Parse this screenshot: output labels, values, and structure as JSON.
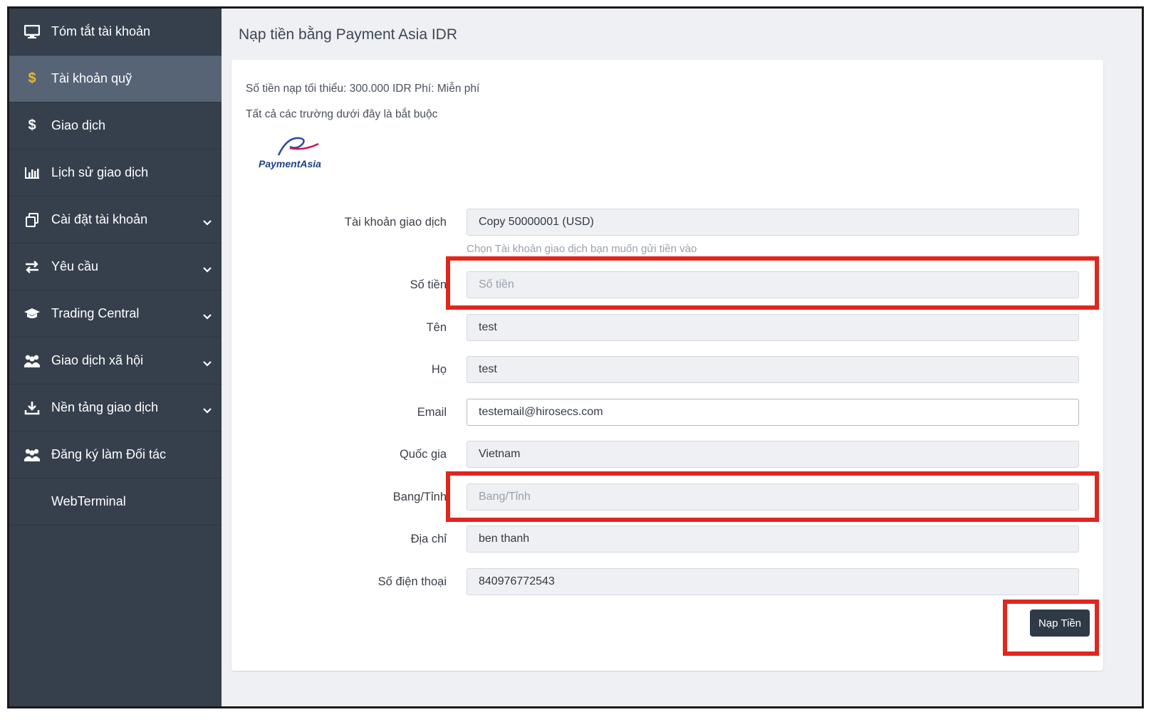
{
  "sidebar": {
    "items": [
      {
        "label": "Tóm tắt tài khoản"
      },
      {
        "label": "Tài khoản quỹ"
      },
      {
        "label": "Giao dịch"
      },
      {
        "label": "Lịch sử giao dịch"
      },
      {
        "label": "Cài đặt tài khoản"
      },
      {
        "label": "Yêu cầu"
      },
      {
        "label": "Trading Central"
      },
      {
        "label": "Giao dịch xã hội"
      },
      {
        "label": "Nền tảng giao dịch"
      },
      {
        "label": "Đăng ký làm Đối tác"
      },
      {
        "label": "WebTerminal"
      }
    ]
  },
  "page": {
    "title": "Nạp tiền bằng Payment Asia IDR",
    "min_deposit_note": "Số tiền nạp tối thiểu: 300.000 IDR Phí: Miễn phí",
    "required_note": "Tất cả các trường dưới đây là bắt buộc",
    "logo_text": "PaymentAsia"
  },
  "form": {
    "account": {
      "label": "Tài khoản giao dịch",
      "value": "Copy 50000001 (USD)",
      "help": "Chọn Tài khoản giao dịch bạn muốn gửi tiền vào"
    },
    "amount": {
      "label": "Số tiền",
      "placeholder": "Số tiền"
    },
    "first_name": {
      "label": "Tên",
      "value": "test"
    },
    "last_name": {
      "label": "Họ",
      "value": "test"
    },
    "email": {
      "label": "Email",
      "value": "testemail@hirosecs.com"
    },
    "country": {
      "label": "Quốc gia",
      "value": "Vietnam"
    },
    "state": {
      "label": "Bang/Tỉnh",
      "placeholder": "Bang/Tỉnh"
    },
    "address": {
      "label": "Địa chỉ",
      "value": "ben thanh"
    },
    "phone": {
      "label": "Số điện thoại",
      "value": "840976772543"
    },
    "submit_label": "Nạp Tiền"
  },
  "colors": {
    "sidebar_bg": "#36404d",
    "sidebar_active": "#576476",
    "highlight": "#e0261d",
    "button": "#2f3a47"
  }
}
